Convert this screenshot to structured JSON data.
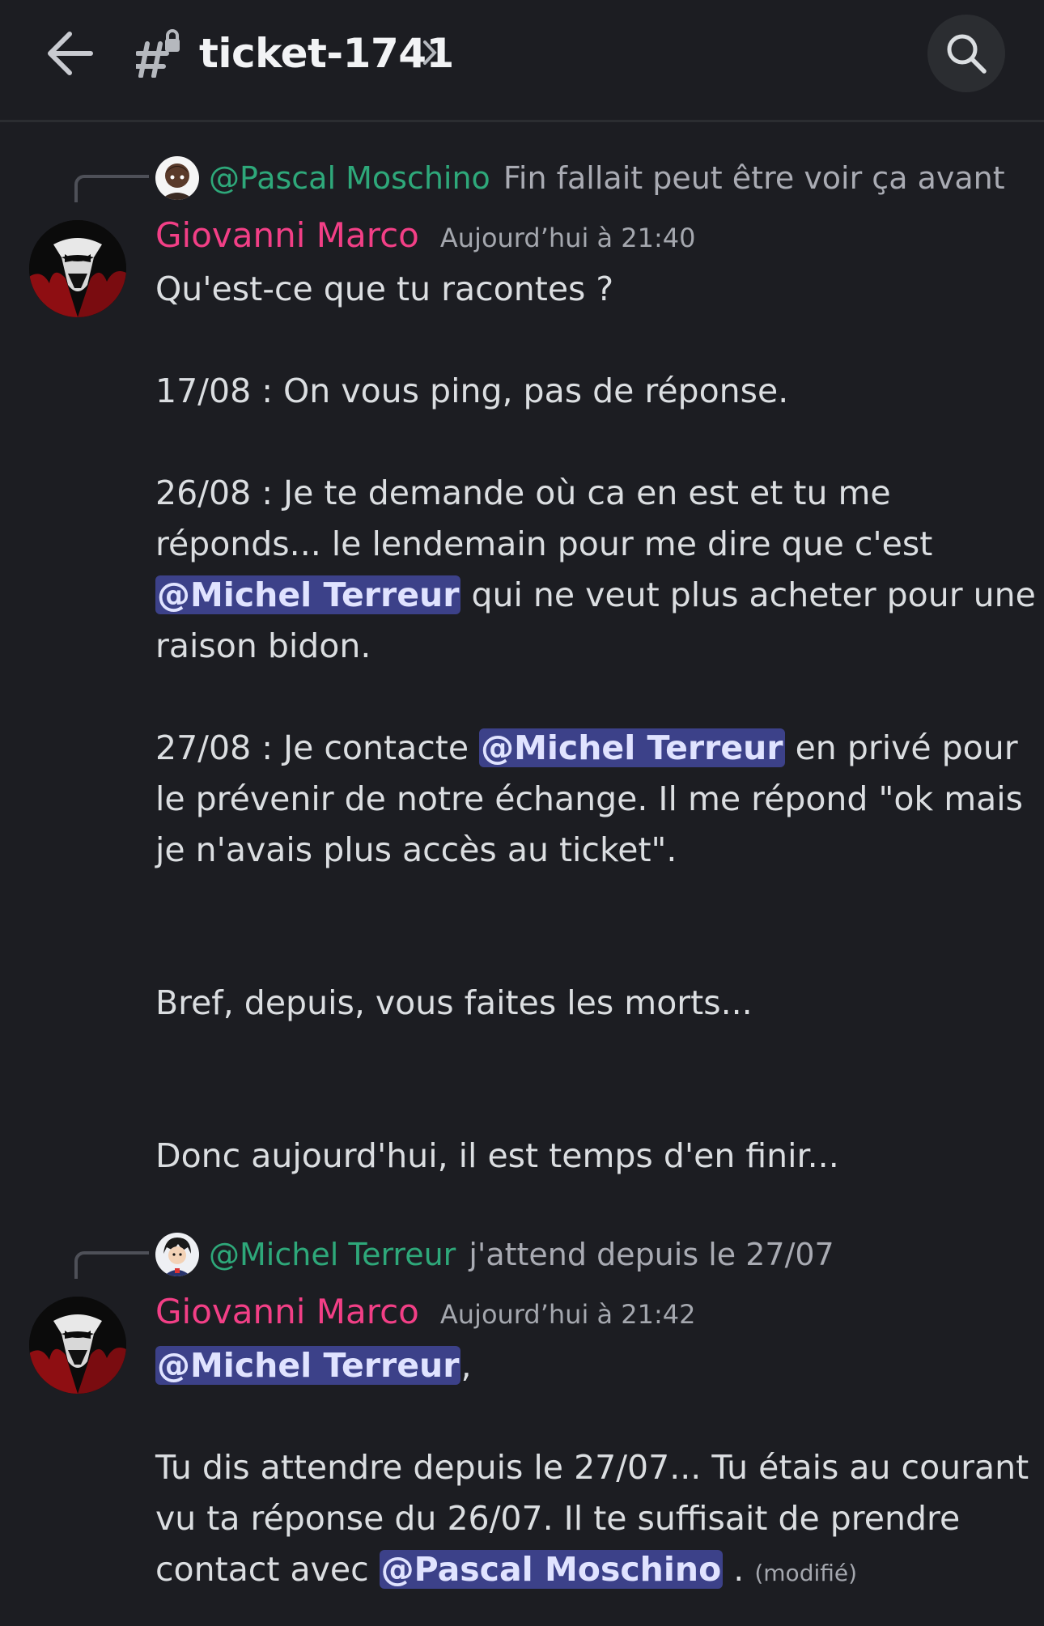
{
  "header": {
    "channel_name": "ticket-1741",
    "back_icon": "arrow-left-icon",
    "channel_icon": "locked-hash-icon",
    "search_icon": "search-icon"
  },
  "messages": [
    {
      "reply": {
        "mention": "@Pascal Moschino",
        "text": "Fin fallait peut être voir ça avant"
      },
      "author": "Giovanni Marco",
      "timestamp": "Aujourd’hui à 21:40",
      "lines": {
        "l1": "Qu'est-ce que tu racontes ?",
        "l2": "17/08 : On vous ping, pas de réponse.",
        "l3": "26/08 : Je te demande où ca en est et tu me",
        "l4": "réponds... le lendemain pour me dire que c'est",
        "l5_mention": "@Michel Terreur",
        "l5_rest": " qui ne veut plus acheter pour une",
        "l6": "raison bidon.",
        "l7_pre": "27/08 : Je contacte ",
        "l7_mention": "@Michel Terreur",
        "l7_post": " en privé pour",
        "l8": "le prévenir de notre échange. Il me répond \"ok mais",
        "l9": "je n'avais plus accès au ticket\".",
        "l10": "Bref, depuis, vous faites les morts...",
        "l11": "Donc aujourd'hui, il est temps d'en finir..."
      }
    },
    {
      "reply": {
        "mention": "@Michel Terreur",
        "text": "j'attend depuis le 27/07"
      },
      "author": "Giovanni Marco",
      "timestamp": "Aujourd’hui à 21:42",
      "lines": {
        "l1_mention": "@Michel Terreur",
        "l1_post": ",",
        "l2": "Tu dis attendre depuis le 27/07... Tu étais au courant",
        "l3": "vu ta réponse du 26/07. Il te suffisait de prendre",
        "l4_pre": "contact avec ",
        "l4_mention": "@Pascal Moschino",
        "l4_post": " . ",
        "edited": "(modifié)"
      }
    }
  ],
  "colors": {
    "background": "#1c1d22",
    "author": "#f23f86",
    "reply_mention": "#2ea87a",
    "mention_bg": "#3c4189"
  }
}
